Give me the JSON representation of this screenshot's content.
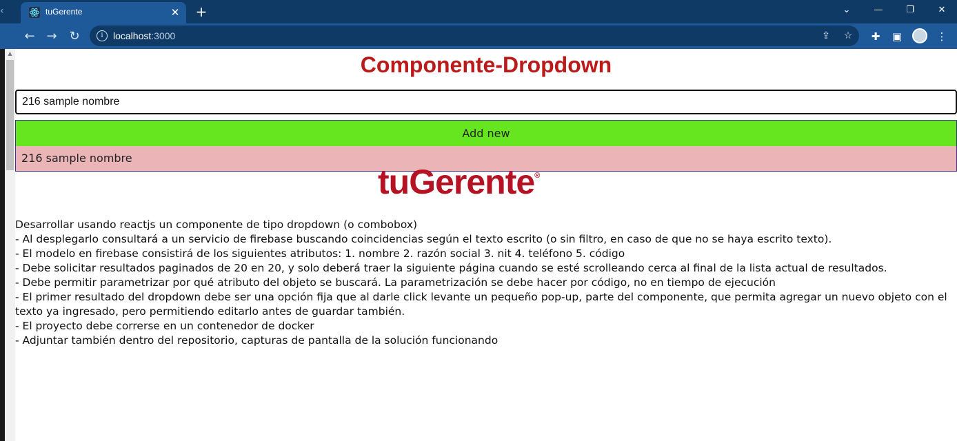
{
  "browser": {
    "tab_title": "tuGerente",
    "tab_close": "✕",
    "new_tab": "+",
    "url_host": "localhost",
    "url_port": ":3000"
  },
  "page": {
    "title": "Componente-Dropdown",
    "search": {
      "value": "216 sample nombre"
    },
    "dropdown": {
      "add_new_label": "Add new",
      "options": [
        "216 sample nombre"
      ]
    },
    "logo": {
      "text": "tuGerente",
      "mark": "®"
    },
    "description": [
      "Desarrollar usando reactjs un componente de tipo dropdown (o combobox)",
      "- Al desplegarlo consultará a un servicio de firebase buscando coincidencias según el texto escrito (o sin filtro, en caso de que no se haya escrito texto).",
      "- El modelo en firebase consistirá de los siguientes atributos: 1. nombre 2. razón social 3. nit 4. teléfono 5. código",
      "- Debe solicitar resultados paginados de 20 en 20, y solo deberá traer la siguiente página cuando se esté scrolleando cerca al final de la lista actual de resultados.",
      "- Debe permitir parametrizar por qué atributo del objeto se buscará. La parametrización se debe hacer por código, no en tiempo de ejecución",
      "- El primer resultado del dropdown debe ser una opción fija que al darle click levante un pequeño pop-up, parte del componente, que permita agregar un nuevo objeto con el texto ya ingresado, pero permitiendo editarlo antes de guardar también.",
      "- El proyecto debe correrse en un contenedor de docker",
      "- Adjuntar también dentro del repositorio, capturas de pantalla de la solución funcionando"
    ]
  },
  "colors": {
    "title": "#bb1a1a",
    "add_new_bg": "#66e61f",
    "option_bg": "#ebb4b7",
    "logo": "#b51224",
    "chrome_dark": "#0f3a66",
    "chrome_light": "#1e5a9a"
  }
}
